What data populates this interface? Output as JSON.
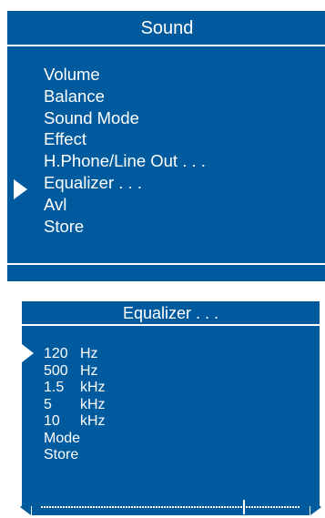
{
  "sound_menu": {
    "title": "Sound",
    "items": [
      "Volume",
      "Balance",
      "Sound Mode",
      "Effect",
      "H.Phone/Line Out . . .",
      "Equalizer . . .",
      "Avl",
      "Store"
    ],
    "selected_index": 5
  },
  "equalizer_menu": {
    "title": "Equalizer . . .",
    "bands": [
      {
        "value": "120",
        "unit": "Hz"
      },
      {
        "value": "500",
        "unit": "Hz"
      },
      {
        "value": "1.5",
        "unit": "kHz"
      },
      {
        "value": "5",
        "unit": "kHz"
      },
      {
        "value": "10",
        "unit": "kHz"
      }
    ],
    "mode_label": "Mode",
    "store_label": "Store",
    "selected_index": 0,
    "slider_level": 0.78
  }
}
